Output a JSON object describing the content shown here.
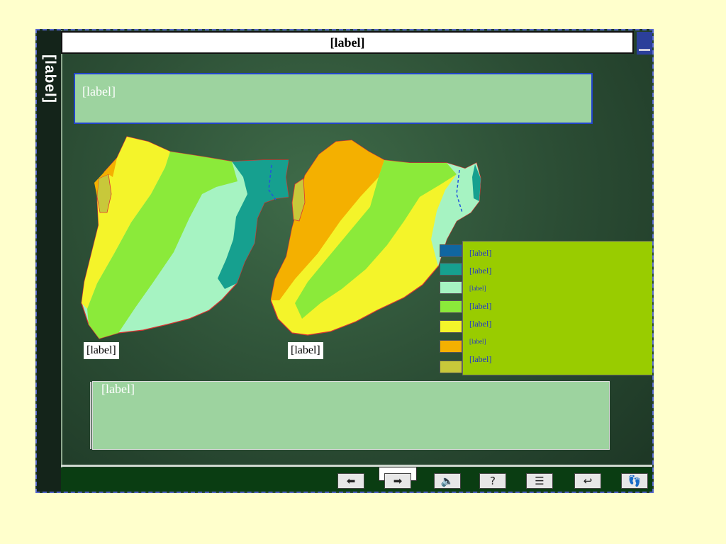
{
  "app": {
    "sidebar_title": "[label]",
    "title": "[label]"
  },
  "colors": {
    "page_bg": "#ffffcc",
    "board_green": "#2a4b33",
    "text_box_green": "#9dd39f",
    "legend_bg": "#99cc00",
    "legend_text": "#2233cc",
    "frame_border": "#5566cc"
  },
  "headline": {
    "text": "[label]"
  },
  "maps": {
    "humid_caption": "[label]",
    "arid_caption": "[label]"
  },
  "legend": {
    "items": [
      {
        "label": "[label]",
        "color": "#1066a0"
      },
      {
        "label": "[label]",
        "color": "#16a08f"
      },
      {
        "label": "[label]",
        "color": "#a6f3c2"
      },
      {
        "label": "[label]",
        "color": "#8bea3a"
      },
      {
        "label": "[label]",
        "color": "#f4f42a"
      },
      {
        "label": "[label]",
        "color": "#f4b000"
      },
      {
        "label": "[label]",
        "color": "#c8c83a"
      }
    ]
  },
  "note": {
    "text": "[label]"
  },
  "navigation": {
    "buttons": [
      {
        "name": "back-button",
        "icon": "back-arrow-icon",
        "glyph": "⬅"
      },
      {
        "name": "forward-button",
        "icon": "forward-arrow-icon",
        "glyph": "➡"
      },
      {
        "name": "sound-button",
        "icon": "speaker-icon",
        "glyph": "🔈"
      },
      {
        "name": "help-button",
        "icon": "question-icon",
        "glyph": "?"
      },
      {
        "name": "menu-button",
        "icon": "menu-icon",
        "glyph": "☰"
      },
      {
        "name": "return-button",
        "icon": "return-icon",
        "glyph": "↩"
      },
      {
        "name": "footprint-button",
        "icon": "footprint-icon",
        "glyph": "👣"
      }
    ]
  }
}
